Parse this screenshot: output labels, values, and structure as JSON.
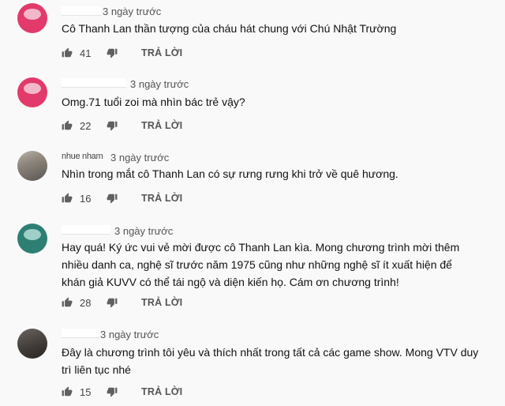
{
  "comments": [
    {
      "author": "",
      "time": "3 ngày trước",
      "text": "Cô Thanh Lan thần tượng của cháu hát chung với Chú Nhật Trường",
      "likes": "41",
      "reply": "TRẢ LỜI",
      "avatar": "pink-default-avatar"
    },
    {
      "author": "",
      "time": "3 ngày trước",
      "text": "Omg.71 tuổi zoi mà nhìn bác trẻ vậy?",
      "likes": "22",
      "reply": "TRẢ LỜI",
      "avatar": "pink-default-avatar"
    },
    {
      "author": "nhue nham",
      "time": "3 ngày trước",
      "text": "Nhìn trong mắt cô Thanh Lan có sự rưng rưng khi trở về quê hương.",
      "likes": "16",
      "reply": "TRẢ LỜI",
      "avatar": "photo-avatar"
    },
    {
      "author": "",
      "time": "3 ngày trước",
      "text": "Hay quá! Ký ức vui vẻ mời được cô Thanh Lan kìa. Mong chương trình mời thêm nhiều danh ca, nghệ sĩ trước năm 1975 cũng như những nghệ sĩ ít xuất hiện để khán giả KUVV có thể tái ngộ và diện kiến họ. Cám ơn chương trình!",
      "likes": "28",
      "reply": "TRẢ LỜI",
      "avatar": "green-default-avatar"
    },
    {
      "author": "",
      "time": "3 ngày trước",
      "text": "Đây là chương trình tôi yêu và thích nhất trong tất cả các game show. Mong VTV duy trì liên tục nhé",
      "likes": "15",
      "reply": "TRẢ LỜI",
      "avatar": "photo-avatar"
    }
  ]
}
